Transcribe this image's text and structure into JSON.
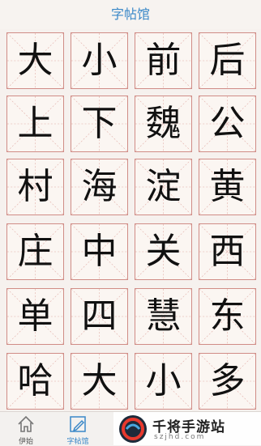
{
  "header": {
    "title": "字帖馆"
  },
  "grid": {
    "rows": [
      [
        "大",
        "小",
        "前",
        "后"
      ],
      [
        "上",
        "下",
        "魏",
        "公"
      ],
      [
        "村",
        "海",
        "淀",
        "黄"
      ],
      [
        "庄",
        "中",
        "关",
        "西"
      ],
      [
        "单",
        "四",
        "慧",
        "东"
      ],
      [
        "哈",
        "大",
        "小",
        "多"
      ]
    ]
  },
  "tabbar": {
    "tabs": [
      {
        "label": "伊始",
        "icon": "home-icon",
        "active": false
      },
      {
        "label": "字帖馆",
        "icon": "pencil-icon",
        "active": true
      },
      {
        "label": "",
        "icon": "camera-icon",
        "active": false
      }
    ]
  },
  "watermark": {
    "title": "千将手游站",
    "url": "szjhd.com"
  },
  "colors": {
    "accent": "#3a88c8",
    "grid_border": "#d08c86",
    "guide_line": "#e0aaa4"
  }
}
